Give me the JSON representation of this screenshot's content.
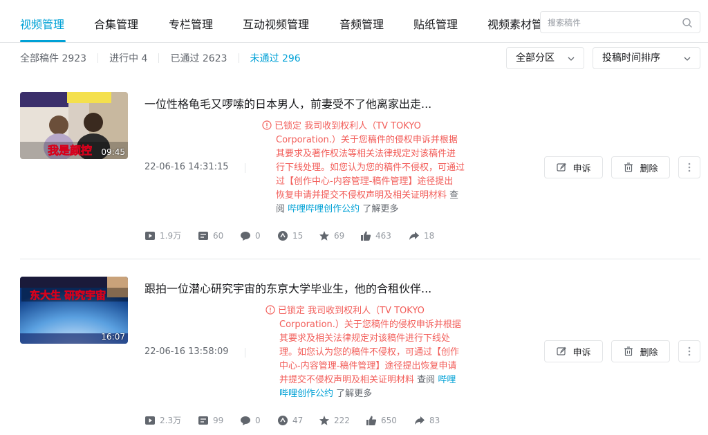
{
  "tabs": [
    {
      "label": "视频管理",
      "active": true
    },
    {
      "label": "合集管理"
    },
    {
      "label": "专栏管理"
    },
    {
      "label": "互动视频管理"
    },
    {
      "label": "音频管理"
    },
    {
      "label": "贴纸管理"
    },
    {
      "label": "视频素材管"
    }
  ],
  "search": {
    "placeholder": "搜索稿件"
  },
  "filters": [
    {
      "label": "全部稿件 2923"
    },
    {
      "label": "进行中 4"
    },
    {
      "label": "已通过 2623"
    },
    {
      "label": "未通过 296",
      "active": true
    }
  ],
  "dropdowns": {
    "category": "全部分区",
    "sort": "投稿时间排序"
  },
  "colors": {
    "accent": "#00a1d6",
    "alert": "#f25d59",
    "muted": "#9499a0"
  },
  "items": [
    {
      "title": "一位性格龟毛又啰嗦的日本男人，前妻受不了他离家出走...",
      "duration": "09:45",
      "thumb_caption": "我是颜控",
      "time": "22-06-16 14:31:15",
      "notice_lines": [
        "已锁定 我司收到权利人（TV TOKYO",
        "Corporation.）关于您稿件的侵权申诉并根据",
        "其要求及著作权法等相关法律规定对该稿件进",
        "行下线处理。如您认为您的稿件不侵权，可通过",
        "过【创作中心-内容管理-稿件管理】途径提出",
        "恢复申请并提交不侵权声明及相关证明材料"
      ],
      "notice_tail_gray": "查",
      "notice_line7_gray": "阅",
      "notice_link": "哔哩哔哩创作公约",
      "notice_end": "了解更多",
      "appeal": "申诉",
      "delete": "删除",
      "stats": {
        "views": "1.9万",
        "danmaku": "60",
        "comments": "0",
        "coins": "15",
        "favorites": "69",
        "likes": "463",
        "shares": "18"
      }
    },
    {
      "title": "跟拍一位潜心研究宇宙的东京大学毕业生，他的合租伙伴...",
      "duration": "16:07",
      "thumb_caption": "东大生 研究宇宙",
      "time": "22-06-16 13:58:09",
      "notice_lines": [
        "已锁定 我司收到权利人（TV TOKYO",
        "Corporation.）关于您稿件的侵权申诉并根据",
        "其要求及相关法律规定对该稿件进行下线处",
        "理。如您认为您的稿件不侵权，可通过【创作",
        "中心-内容管理-稿件管理】途径提出恢复申请",
        "并提交不侵权声明及相关证明材料"
      ],
      "notice_tail_gray": "查阅",
      "notice_link_a": "哔哩",
      "notice_link_b": "哔哩创作公约",
      "notice_end": "了解更多",
      "appeal": "申诉",
      "delete": "删除",
      "stats": {
        "views": "2.3万",
        "danmaku": "99",
        "comments": "0",
        "coins": "47",
        "favorites": "222",
        "likes": "650",
        "shares": "83"
      }
    }
  ]
}
